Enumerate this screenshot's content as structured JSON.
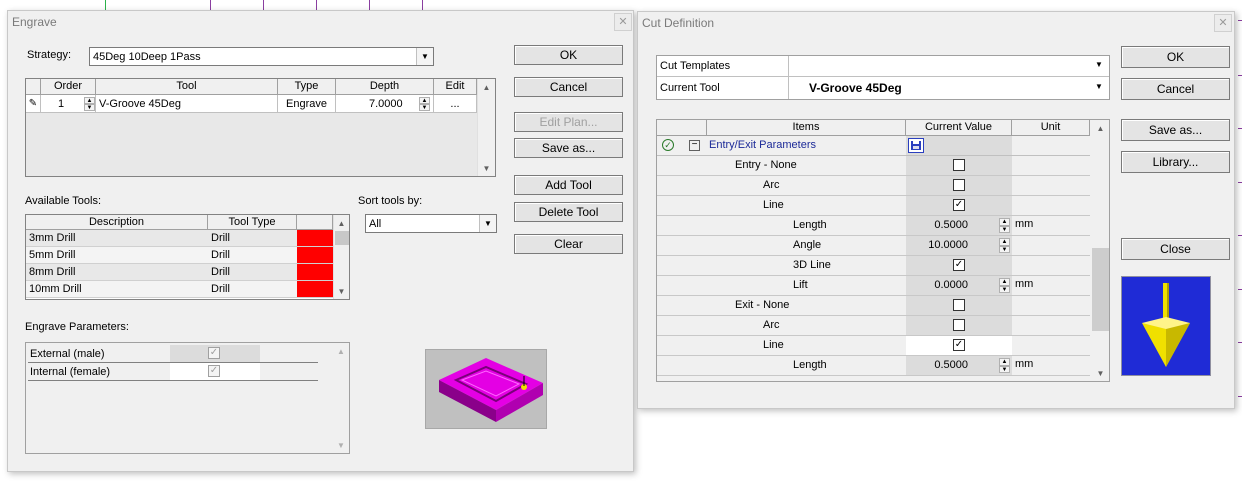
{
  "engrave": {
    "title": "Engrave",
    "close_glyph": "✕",
    "strategy_label": "Strategy:",
    "strategy_value": "45Deg 10Deep 1Pass",
    "table_headers": {
      "order": "Order",
      "tool": "Tool",
      "type": "Type",
      "depth": "Depth",
      "edit": "Edit"
    },
    "table_row": {
      "order": "1",
      "tool": "V-Groove 45Deg",
      "type": "Engrave",
      "depth": "7.0000",
      "edit": "..."
    },
    "buttons": {
      "ok": "OK",
      "cancel": "Cancel",
      "edit_plan": "Edit Plan...",
      "save_as": "Save as...",
      "add_tool": "Add Tool",
      "delete_tool": "Delete Tool",
      "clear": "Clear"
    },
    "available_tools_label": "Available Tools:",
    "tools_headers": {
      "description": "Description",
      "tool_type": "Tool Type"
    },
    "tools": [
      {
        "description": "3mm Drill",
        "type": "Drill",
        "color": "#ff0000"
      },
      {
        "description": "5mm Drill",
        "type": "Drill",
        "color": "#ff0000"
      },
      {
        "description": "8mm Drill",
        "type": "Drill",
        "color": "#ff0000"
      },
      {
        "description": "10mm Drill",
        "type": "Drill",
        "color": "#ff0000"
      }
    ],
    "sort_label": "Sort tools by:",
    "sort_value": "All",
    "engrave_params_label": "Engrave Parameters:",
    "params": [
      {
        "label": "External (male)",
        "checked": true
      },
      {
        "label": "Internal (female)",
        "checked": true
      }
    ]
  },
  "cut": {
    "title": "Cut Definition",
    "close_glyph": "✕",
    "cut_templates_label": "Cut Templates",
    "cut_templates_value": "",
    "current_tool_label": "Current Tool",
    "current_tool_value": "V-Groove 45Deg",
    "headers": {
      "items": "Items",
      "current_value": "Current Value",
      "unit": "Unit"
    },
    "group_title": "Entry/Exit Parameters",
    "rows": [
      {
        "label": "Entry - None",
        "indent": 1,
        "kind": "check",
        "checked": false,
        "unit": ""
      },
      {
        "label": "Arc",
        "indent": 2,
        "kind": "check",
        "checked": false,
        "unit": ""
      },
      {
        "label": "Line",
        "indent": 2,
        "kind": "check",
        "checked": true,
        "unit": ""
      },
      {
        "label": "Length",
        "indent": 3,
        "kind": "num",
        "value": "0.5000",
        "unit": "mm"
      },
      {
        "label": "Angle",
        "indent": 3,
        "kind": "num",
        "value": "10.0000",
        "unit": ""
      },
      {
        "label": "3D Line",
        "indent": 3,
        "kind": "check",
        "checked": true,
        "unit": ""
      },
      {
        "label": "Lift",
        "indent": 3,
        "kind": "num",
        "value": "0.0000",
        "unit": "mm"
      },
      {
        "label": "Exit - None",
        "indent": 1,
        "kind": "check",
        "checked": false,
        "unit": ""
      },
      {
        "label": "Arc",
        "indent": 2,
        "kind": "check",
        "checked": false,
        "unit": ""
      },
      {
        "label": "Line",
        "indent": 2,
        "kind": "check",
        "checked": true,
        "unit": "",
        "white": true
      },
      {
        "label": "Length",
        "indent": 3,
        "kind": "num",
        "value": "0.5000",
        "unit": "mm"
      }
    ],
    "buttons": {
      "ok": "OK",
      "cancel": "Cancel",
      "save_as": "Save as...",
      "library": "Library...",
      "close": "Close"
    }
  },
  "colors": {
    "magenta_preview": "#e400e4",
    "tool_blue": "#1f2bd6",
    "tool_yellow": "#f0e000",
    "tool_red": "#ff0000"
  }
}
